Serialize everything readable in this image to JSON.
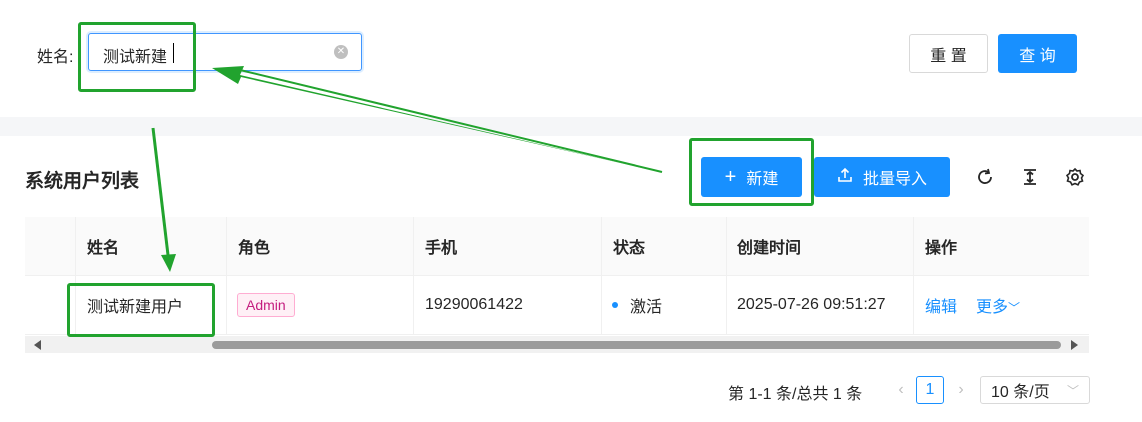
{
  "search": {
    "name_label": "姓名:",
    "name_value": "测试新建",
    "reset_label": "重 置",
    "query_label": "查 询"
  },
  "toolbar": {
    "title": "系统用户列表",
    "new_label": "新建",
    "import_label": "批量导入",
    "icons": [
      "reload-icon",
      "column-height-icon",
      "setting-icon"
    ]
  },
  "table": {
    "columns": [
      "姓名",
      "角色",
      "手机",
      "状态",
      "创建时间",
      "操作"
    ],
    "rows": [
      {
        "name": "测试新建用户",
        "role": "Admin",
        "phone": "19290061422",
        "status": "激活",
        "created": "2025-07-26 09:51:27",
        "edit": "编辑",
        "more": "更多"
      }
    ]
  },
  "pagination": {
    "total_text": "第 1-1 条/总共 1 条",
    "current_page": "1",
    "page_size": "10 条/页"
  },
  "colors": {
    "primary": "#1890ff",
    "annotation_green": "#21a32e",
    "admin_tag": "#c41d7f"
  }
}
